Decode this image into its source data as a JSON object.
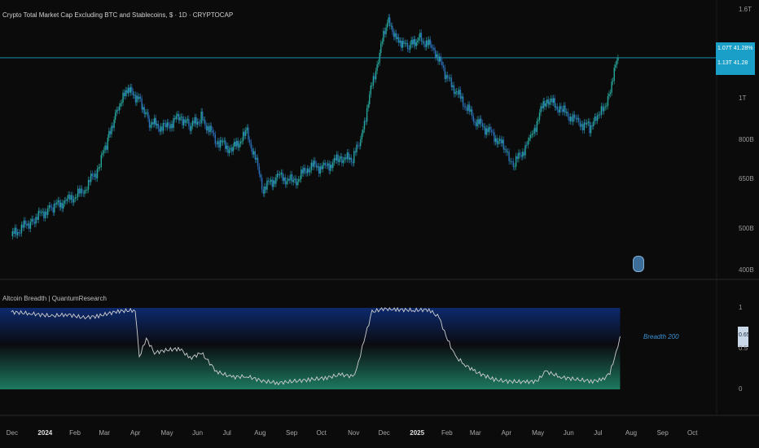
{
  "title": "Crypto Total Market Cap Excluding BTC and Stablecoins, $ · 1D · CRYPTOCAP",
  "indicator_title": "Altcoin Breadth | QuantumResearch",
  "price_tag": {
    "line1": "1.07T 41.28%",
    "line2": "1.13T 41.28"
  },
  "indicator_value_tag": "0.65",
  "series_label": "Breadth 200",
  "colors": {
    "bull": "#26a69a",
    "bear": "#2a6fb8",
    "price_line": "#1aa0c8",
    "band_top": "#0d2a6e",
    "band_bottom": "#1d7a60",
    "breadth_line": "#cfcfcf"
  },
  "chart_data": [
    {
      "type": "line",
      "title": "Crypto Total Market Cap Excluding BTC and Stablecoins, $ · 1D · CRYPTOCAP",
      "ylabel": "",
      "scale": "log",
      "yticks": [
        "1.6T",
        "1T",
        "800B",
        "650B",
        "500B",
        "400B"
      ],
      "ylim": [
        390,
        1650
      ],
      "x": [
        "2023-12-01",
        "2023-12-20",
        "2024-01-10",
        "2024-01-25",
        "2024-02-10",
        "2024-02-25",
        "2024-03-05",
        "2024-03-15",
        "2024-03-25",
        "2024-04-05",
        "2024-04-15",
        "2024-04-30",
        "2024-05-15",
        "2024-05-25",
        "2024-06-05",
        "2024-06-20",
        "2024-07-05",
        "2024-07-20",
        "2024-08-05",
        "2024-08-20",
        "2024-09-05",
        "2024-09-20",
        "2024-10-05",
        "2024-10-20",
        "2024-11-01",
        "2024-11-10",
        "2024-11-25",
        "2024-12-05",
        "2024-12-15",
        "2024-12-25",
        "2025-01-05",
        "2025-01-20",
        "2025-02-01",
        "2025-02-15",
        "2025-03-01",
        "2025-03-15",
        "2025-04-01",
        "2025-04-08",
        "2025-04-25",
        "2025-05-10",
        "2025-05-25",
        "2025-06-10",
        "2025-06-22",
        "2025-07-01",
        "2025-07-10",
        "2025-07-20"
      ],
      "y": [
        480,
        520,
        560,
        580,
        610,
        690,
        800,
        960,
        1040,
        1000,
        880,
        850,
        910,
        860,
        900,
        800,
        760,
        830,
        620,
        660,
        640,
        700,
        690,
        730,
        720,
        820,
        1200,
        1500,
        1380,
        1300,
        1380,
        1300,
        1120,
        1000,
        890,
        840,
        760,
        700,
        800,
        1000,
        940,
        880,
        860,
        900,
        1000,
        1240
      ]
    },
    {
      "type": "area",
      "title": "Altcoin Breadth | QuantumResearch",
      "series_name": "Breadth 200",
      "yticks": [
        "1",
        "0.5",
        "0"
      ],
      "ylim": [
        0,
        1
      ],
      "x": [
        "2023-12-01",
        "2023-12-20",
        "2024-01-10",
        "2024-01-25",
        "2024-02-10",
        "2024-02-25",
        "2024-03-15",
        "2024-04-01",
        "2024-04-05",
        "2024-04-12",
        "2024-04-20",
        "2024-05-01",
        "2024-05-15",
        "2024-05-25",
        "2024-06-05",
        "2024-06-20",
        "2024-07-05",
        "2024-07-20",
        "2024-08-05",
        "2024-08-20",
        "2024-09-05",
        "2024-09-20",
        "2024-10-05",
        "2024-10-20",
        "2024-11-01",
        "2024-11-05",
        "2024-11-12",
        "2024-11-20",
        "2024-12-01",
        "2024-12-15",
        "2025-01-01",
        "2025-01-15",
        "2025-01-25",
        "2025-02-01",
        "2025-02-10",
        "2025-02-20",
        "2025-03-01",
        "2025-03-20",
        "2025-04-01",
        "2025-04-20",
        "2025-05-01",
        "2025-05-10",
        "2025-05-25",
        "2025-06-10",
        "2025-06-25",
        "2025-07-05",
        "2025-07-12",
        "2025-07-18",
        "2025-07-22"
      ],
      "y": [
        0.95,
        0.93,
        0.9,
        0.92,
        0.88,
        0.9,
        0.96,
        0.97,
        0.4,
        0.62,
        0.45,
        0.48,
        0.5,
        0.38,
        0.45,
        0.22,
        0.15,
        0.16,
        0.1,
        0.08,
        0.1,
        0.12,
        0.14,
        0.18,
        0.16,
        0.25,
        0.6,
        0.95,
        0.99,
        0.98,
        0.97,
        0.98,
        0.88,
        0.65,
        0.4,
        0.3,
        0.22,
        0.12,
        0.1,
        0.09,
        0.1,
        0.22,
        0.15,
        0.12,
        0.1,
        0.12,
        0.2,
        0.45,
        0.65
      ]
    }
  ],
  "xticks": [
    {
      "label": "Dec",
      "year": false
    },
    {
      "label": "2024",
      "year": true
    },
    {
      "label": "Feb",
      "year": false
    },
    {
      "label": "Mar",
      "year": false
    },
    {
      "label": "Apr",
      "year": false
    },
    {
      "label": "May",
      "year": false
    },
    {
      "label": "Jun",
      "year": false
    },
    {
      "label": "Jul",
      "year": false
    },
    {
      "label": "Aug",
      "year": false
    },
    {
      "label": "Sep",
      "year": false
    },
    {
      "label": "Oct",
      "year": false
    },
    {
      "label": "Nov",
      "year": false
    },
    {
      "label": "Dec",
      "year": false
    },
    {
      "label": "2025",
      "year": true
    },
    {
      "label": "Feb",
      "year": false
    },
    {
      "label": "Mar",
      "year": false
    },
    {
      "label": "Apr",
      "year": false
    },
    {
      "label": "May",
      "year": false
    },
    {
      "label": "Jun",
      "year": false
    },
    {
      "label": "Jul",
      "year": false
    },
    {
      "label": "Aug",
      "year": false
    },
    {
      "label": "Sep",
      "year": false
    },
    {
      "label": "Oct",
      "year": false
    }
  ]
}
